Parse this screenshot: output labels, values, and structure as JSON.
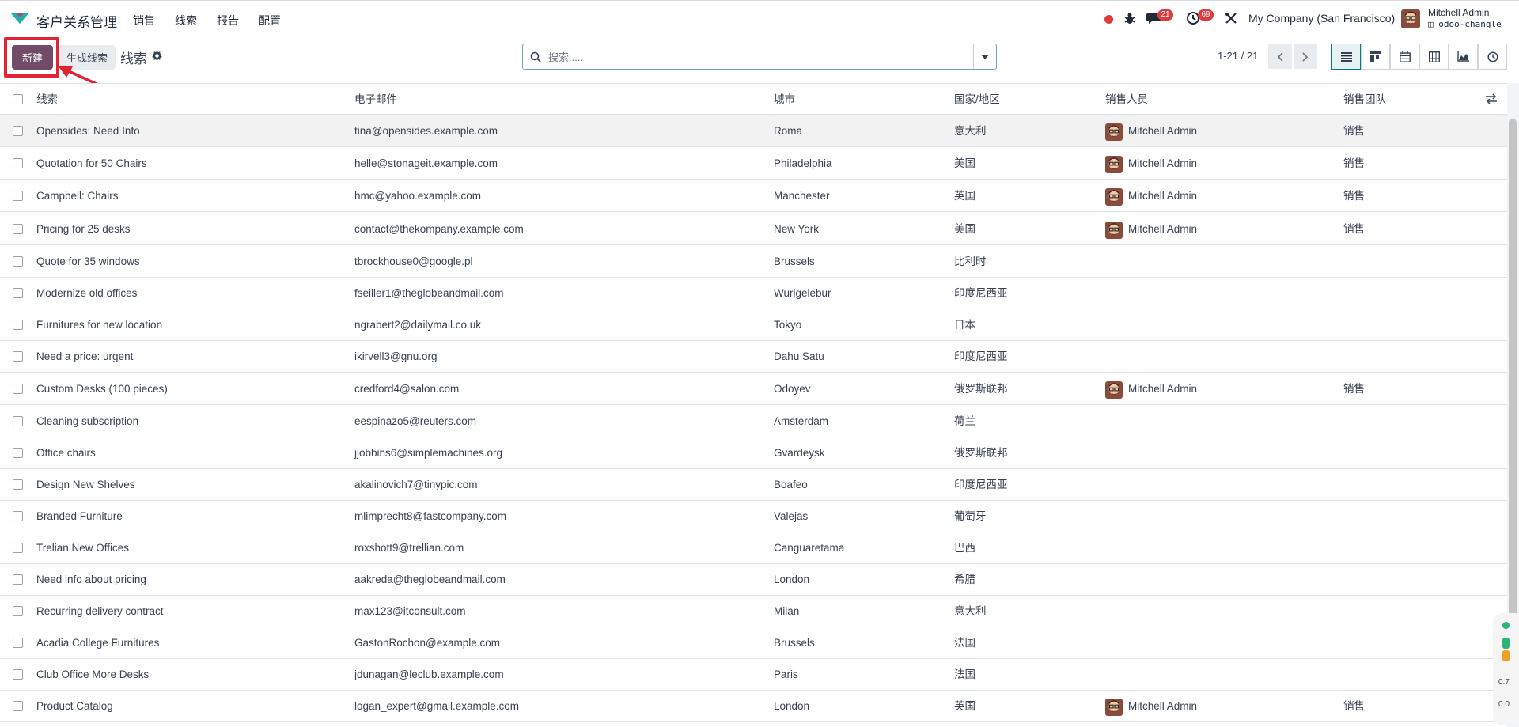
{
  "navbar": {
    "app_title": "客户关系管理",
    "menu": [
      "销售",
      "线索",
      "报告",
      "配置"
    ],
    "chat_badge": "21",
    "activity_badge": "69",
    "company": "My Company (San Francisco)",
    "user_name": "Mitchell Admin",
    "db_name": "odoo-changle"
  },
  "control_panel": {
    "new_label": "新建",
    "generate_label": "生成线索",
    "title": "线索",
    "search_placeholder": "搜索.....",
    "pager": "1-21 / 21"
  },
  "table": {
    "columns": [
      "线索",
      "电子邮件",
      "城市",
      "国家/地区",
      "销售人员",
      "销售团队"
    ],
    "rows": [
      {
        "lead": "Opensides: Need Info",
        "email": "tina@opensides.example.com",
        "city": "Roma",
        "country": "意大利",
        "salesperson": "Mitchell Admin",
        "team": "销售"
      },
      {
        "lead": "Quotation for 50 Chairs",
        "email": "helle@stonageit.example.com",
        "city": "Philadelphia",
        "country": "美国",
        "salesperson": "Mitchell Admin",
        "team": "销售"
      },
      {
        "lead": "Campbell: Chairs",
        "email": "hmc@yahoo.example.com",
        "city": "Manchester",
        "country": "英国",
        "salesperson": "Mitchell Admin",
        "team": "销售"
      },
      {
        "lead": "Pricing for 25 desks",
        "email": "contact@thekompany.example.com",
        "city": "New York",
        "country": "美国",
        "salesperson": "Mitchell Admin",
        "team": "销售"
      },
      {
        "lead": "Quote for 35 windows",
        "email": "tbrockhouse0@google.pl",
        "city": "Brussels",
        "country": "比利时",
        "salesperson": "",
        "team": ""
      },
      {
        "lead": "Modernize old offices",
        "email": "fseiller1@theglobeandmail.com",
        "city": "Wurigelebur",
        "country": "印度尼西亚",
        "salesperson": "",
        "team": ""
      },
      {
        "lead": "Furnitures for new location",
        "email": "ngrabert2@dailymail.co.uk",
        "city": "Tokyo",
        "country": "日本",
        "salesperson": "",
        "team": ""
      },
      {
        "lead": "Need a price: urgent",
        "email": "ikirvell3@gnu.org",
        "city": "Dahu Satu",
        "country": "印度尼西亚",
        "salesperson": "",
        "team": ""
      },
      {
        "lead": "Custom Desks (100 pieces)",
        "email": "credford4@salon.com",
        "city": "Odoyev",
        "country": "俄罗斯联邦",
        "salesperson": "Mitchell Admin",
        "team": "销售"
      },
      {
        "lead": "Cleaning subscription",
        "email": "eespinazo5@reuters.com",
        "city": "Amsterdam",
        "country": "荷兰",
        "salesperson": "",
        "team": ""
      },
      {
        "lead": "Office chairs",
        "email": "jjobbins6@simplemachines.org",
        "city": "Gvardeysk",
        "country": "俄罗斯联邦",
        "salesperson": "",
        "team": ""
      },
      {
        "lead": "Design New Shelves",
        "email": "akalinovich7@tinypic.com",
        "city": "Boafeo",
        "country": "印度尼西亚",
        "salesperson": "",
        "team": ""
      },
      {
        "lead": "Branded Furniture",
        "email": "mlimprecht8@fastcompany.com",
        "city": "Valejas",
        "country": "葡萄牙",
        "salesperson": "",
        "team": ""
      },
      {
        "lead": "Trelian New Offices",
        "email": "roxshott9@trellian.com",
        "city": "Canguaretama",
        "country": "巴西",
        "salesperson": "",
        "team": ""
      },
      {
        "lead": "Need info about pricing",
        "email": "aakreda@theglobeandmail.com",
        "city": "London",
        "country": "希腊",
        "salesperson": "",
        "team": ""
      },
      {
        "lead": "Recurring delivery contract",
        "email": "max123@itconsult.com",
        "city": "Milan",
        "country": "意大利",
        "salesperson": "",
        "team": ""
      },
      {
        "lead": "Acadia College Furnitures",
        "email": "GastonRochon@example.com",
        "city": "Brussels",
        "country": "法国",
        "salesperson": "",
        "team": ""
      },
      {
        "lead": "Club Office More Desks",
        "email": "jdunagan@leclub.example.com",
        "city": "Paris",
        "country": "法国",
        "salesperson": "",
        "team": ""
      },
      {
        "lead": "Product Catalog",
        "email": "logan_expert@gmail.example.com",
        "city": "London",
        "country": "英国",
        "salesperson": "Mitchell Admin",
        "team": "销售"
      }
    ]
  },
  "side_widget": {
    "upload": "0.7",
    "download": "0.0"
  },
  "colors": {
    "brand": "#714b67",
    "accent": "#017e84",
    "highlight": "#e32233",
    "badge": "#e03b3b"
  }
}
